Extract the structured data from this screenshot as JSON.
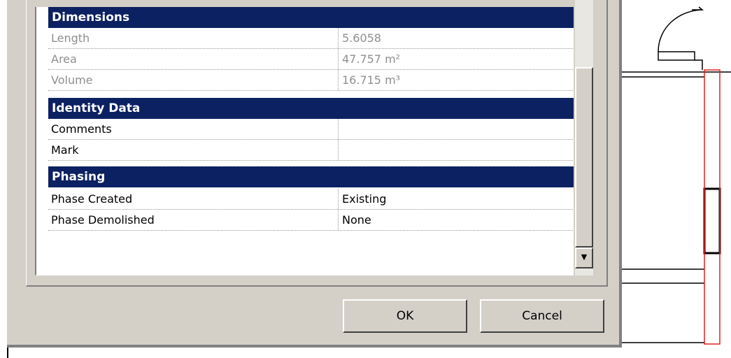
{
  "sections": {
    "dimensions": {
      "title": "Dimensions",
      "collapse_icon": "double-chevron-up-icon",
      "rows": [
        {
          "label": "Length",
          "value": "5.6058"
        },
        {
          "label": "Area",
          "value": "47.757 m²"
        },
        {
          "label": "Volume",
          "value": "16.715 m³"
        }
      ]
    },
    "identity_data": {
      "title": "Identity Data",
      "collapse_icon": "double-chevron-up-icon",
      "rows": [
        {
          "label": "Comments",
          "value": ""
        },
        {
          "label": "Mark",
          "value": ""
        }
      ]
    },
    "phasing": {
      "title": "Phasing",
      "collapse_icon": "double-chevron-up-icon",
      "rows": [
        {
          "label": "Phase Created",
          "value": "Existing"
        },
        {
          "label": "Phase Demolished",
          "value": "None"
        }
      ]
    }
  },
  "chevron_glyph": "≈",
  "buttons": {
    "ok": "OK",
    "cancel": "Cancel"
  },
  "scrollbar": {
    "down_arrow_icon": "triangle-down-icon"
  },
  "colors": {
    "section_header_bg": "#0c2161",
    "dialog_bg": "#d4d0c8",
    "readonly_text": "#8f8f8f",
    "drawing_red": "#e02020"
  }
}
